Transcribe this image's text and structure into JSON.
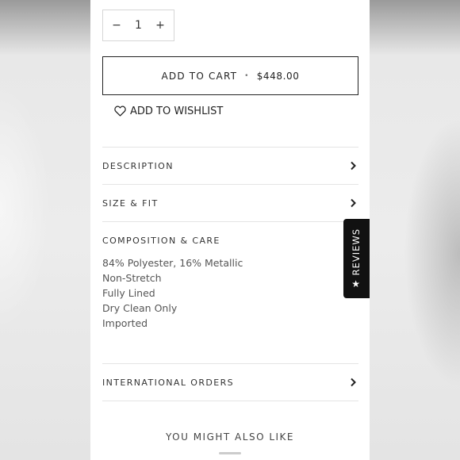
{
  "quantity": {
    "minus": "−",
    "value": "1",
    "plus": "+"
  },
  "cart": {
    "label": "ADD TO CART",
    "separator": "•",
    "price": "$448.00"
  },
  "wishlist": {
    "label": "ADD TO WISHLIST",
    "icon": "heart-outline-icon"
  },
  "accordion": {
    "description": "DESCRIPTION",
    "size_fit": "SIZE & FIT",
    "composition": "COMPOSITION & CARE",
    "international": "INTERNATIONAL ORDERS",
    "chevron": "›"
  },
  "composition_details": [
    "84% Polyester, 16% Metallic",
    "Non-Stretch",
    "Fully Lined",
    "Dry Clean Only",
    "Imported"
  ],
  "also_like": "YOU MIGHT ALSO LIKE",
  "reviews_tab": {
    "label": "REVIEWS",
    "star": "★"
  }
}
